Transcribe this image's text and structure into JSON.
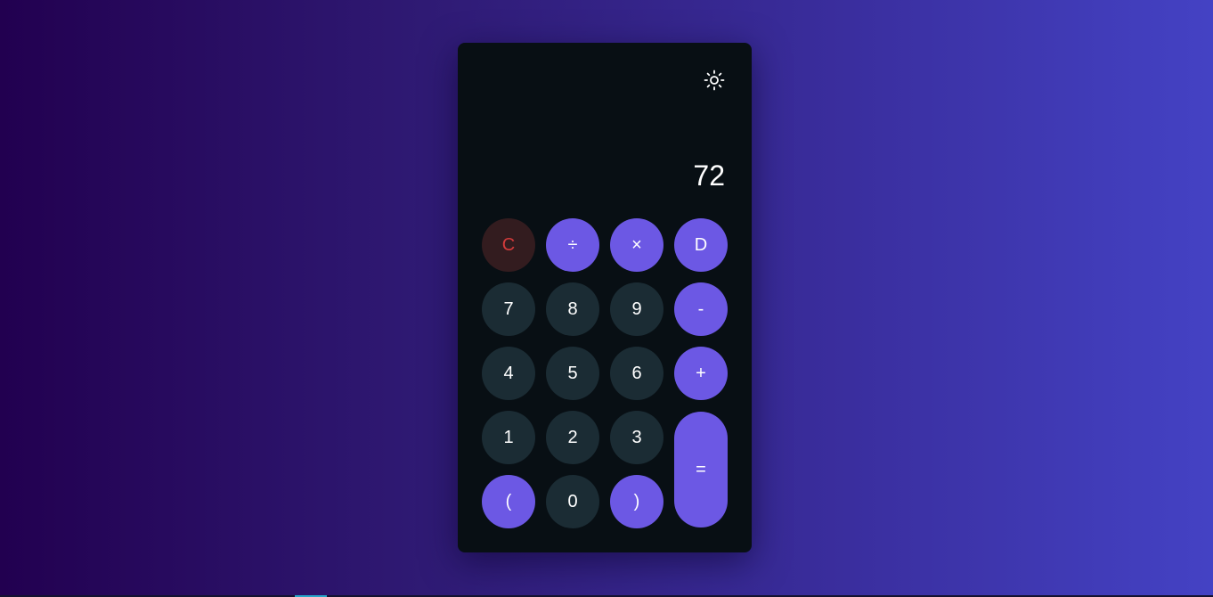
{
  "calculator": {
    "theme_toggle_icon": "sun-icon",
    "display_value": "72",
    "buttons": {
      "clear": "C",
      "divide": "÷",
      "multiply": "×",
      "delete": "D",
      "seven": "7",
      "eight": "8",
      "nine": "9",
      "minus": "-",
      "four": "4",
      "five": "5",
      "six": "6",
      "plus": "+",
      "one": "1",
      "two": "2",
      "three": "3",
      "equals": "=",
      "open_paren": "(",
      "zero": "0",
      "close_paren": ")"
    }
  },
  "colors": {
    "background_start": "#220050",
    "background_end": "#4442c4",
    "panel": "#080f14",
    "number_button": "#1b2c34",
    "operator_button": "#6c58e4",
    "clear_button_bg": "#331c1f",
    "clear_button_text": "#d23b3b"
  }
}
